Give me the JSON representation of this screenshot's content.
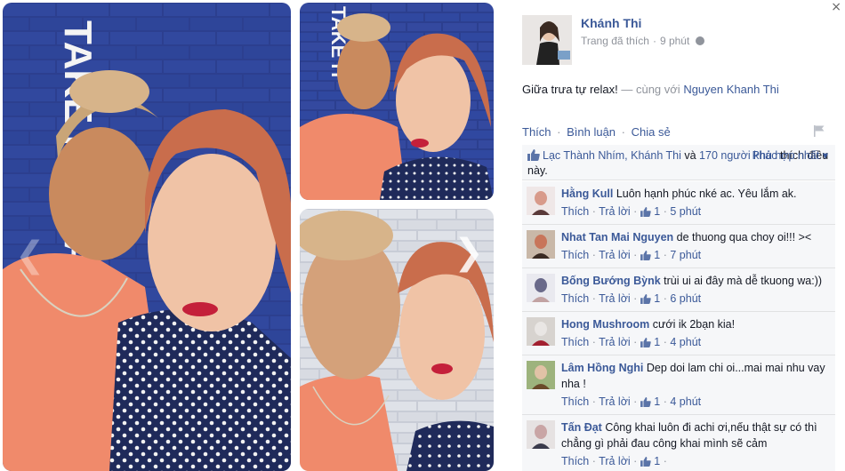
{
  "window": {
    "close_glyph": "×"
  },
  "photos": {
    "next_glyph": "❯",
    "prev_glyph": "❮",
    "main_shirt_text": "TAKE IT AWAY",
    "tr_shirt_text": "TAKE IT"
  },
  "post": {
    "author": "Khánh Thi",
    "subtitle": "Trang đã thích",
    "time": "9 phút",
    "caption_text": "Giữa trưa tự relax!",
    "caption_with": " — cùng với ",
    "caption_tagged": "Nguyen Khanh Thi"
  },
  "actions": {
    "like": "Thích",
    "comment": "Bình luận",
    "share": "Chia sẻ",
    "separator": "·"
  },
  "likes": {
    "names": "Lạc Thành Nhím, Khánh Thi",
    "and": " và ",
    "others": "170 người khác",
    "suffix": " thích điều này.",
    "sort_label": "Phù hợp nhất ▾"
  },
  "comments": [
    {
      "author": "Hằng Kull",
      "text": "Luôn hạnh phúc nké ac. Yêu lắm ak.",
      "like": "Thích",
      "reply": "Trả lời",
      "likes": "1",
      "time": "5 phút"
    },
    {
      "author": "Nhat Tan Mai Nguyen",
      "text": "de thuong qua choy oi!!! ><",
      "like": "Thích",
      "reply": "Trả lời",
      "likes": "1",
      "time": "7 phút"
    },
    {
      "author": "Bống Bướng Bỳnk",
      "text": "trùi ui ai đây mà dễ tkuong wa:))",
      "like": "Thích",
      "reply": "Trả lời",
      "likes": "1",
      "time": "6 phút"
    },
    {
      "author": "Hong Mushroom",
      "text": "cưới ik 2bạn kia!",
      "like": "Thích",
      "reply": "Trả lời",
      "likes": "1",
      "time": "4 phút"
    },
    {
      "author": "Lâm Hồng Nghi",
      "text": "Dep doi lam chi oi...mai mai nhu vay nha !",
      "like": "Thích",
      "reply": "Trả lời",
      "likes": "1",
      "time": "4 phút"
    },
    {
      "author": "Tấn Đạt",
      "text": "Công khai luôn đi achi ơi,nếu thật sự có thì chẳng gì phải đau công khai mình sẽ cảm",
      "like": "Thích",
      "reply": "Trả lời",
      "likes": "1",
      "time": ""
    }
  ],
  "colors": {
    "link": "#3b5998",
    "muted": "#90949c",
    "panel_bg": "#f6f7f9"
  },
  "icons": {
    "globe": "globe-icon",
    "flag": "flag-icon",
    "thumb": "thumbs-up-icon"
  }
}
